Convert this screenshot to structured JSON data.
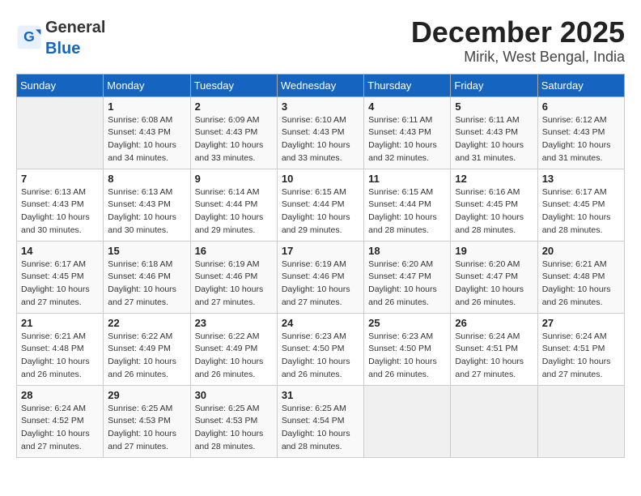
{
  "header": {
    "logo_general": "General",
    "logo_blue": "Blue",
    "title": "December 2025",
    "subtitle": "Mirik, West Bengal, India"
  },
  "calendar": {
    "days_of_week": [
      "Sunday",
      "Monday",
      "Tuesday",
      "Wednesday",
      "Thursday",
      "Friday",
      "Saturday"
    ],
    "weeks": [
      [
        {
          "day": "",
          "info": ""
        },
        {
          "day": "1",
          "info": "Sunrise: 6:08 AM\nSunset: 4:43 PM\nDaylight: 10 hours\nand 34 minutes."
        },
        {
          "day": "2",
          "info": "Sunrise: 6:09 AM\nSunset: 4:43 PM\nDaylight: 10 hours\nand 33 minutes."
        },
        {
          "day": "3",
          "info": "Sunrise: 6:10 AM\nSunset: 4:43 PM\nDaylight: 10 hours\nand 33 minutes."
        },
        {
          "day": "4",
          "info": "Sunrise: 6:11 AM\nSunset: 4:43 PM\nDaylight: 10 hours\nand 32 minutes."
        },
        {
          "day": "5",
          "info": "Sunrise: 6:11 AM\nSunset: 4:43 PM\nDaylight: 10 hours\nand 31 minutes."
        },
        {
          "day": "6",
          "info": "Sunrise: 6:12 AM\nSunset: 4:43 PM\nDaylight: 10 hours\nand 31 minutes."
        }
      ],
      [
        {
          "day": "7",
          "info": "Sunrise: 6:13 AM\nSunset: 4:43 PM\nDaylight: 10 hours\nand 30 minutes."
        },
        {
          "day": "8",
          "info": "Sunrise: 6:13 AM\nSunset: 4:43 PM\nDaylight: 10 hours\nand 30 minutes."
        },
        {
          "day": "9",
          "info": "Sunrise: 6:14 AM\nSunset: 4:44 PM\nDaylight: 10 hours\nand 29 minutes."
        },
        {
          "day": "10",
          "info": "Sunrise: 6:15 AM\nSunset: 4:44 PM\nDaylight: 10 hours\nand 29 minutes."
        },
        {
          "day": "11",
          "info": "Sunrise: 6:15 AM\nSunset: 4:44 PM\nDaylight: 10 hours\nand 28 minutes."
        },
        {
          "day": "12",
          "info": "Sunrise: 6:16 AM\nSunset: 4:45 PM\nDaylight: 10 hours\nand 28 minutes."
        },
        {
          "day": "13",
          "info": "Sunrise: 6:17 AM\nSunset: 4:45 PM\nDaylight: 10 hours\nand 28 minutes."
        }
      ],
      [
        {
          "day": "14",
          "info": "Sunrise: 6:17 AM\nSunset: 4:45 PM\nDaylight: 10 hours\nand 27 minutes."
        },
        {
          "day": "15",
          "info": "Sunrise: 6:18 AM\nSunset: 4:46 PM\nDaylight: 10 hours\nand 27 minutes."
        },
        {
          "day": "16",
          "info": "Sunrise: 6:19 AM\nSunset: 4:46 PM\nDaylight: 10 hours\nand 27 minutes."
        },
        {
          "day": "17",
          "info": "Sunrise: 6:19 AM\nSunset: 4:46 PM\nDaylight: 10 hours\nand 27 minutes."
        },
        {
          "day": "18",
          "info": "Sunrise: 6:20 AM\nSunset: 4:47 PM\nDaylight: 10 hours\nand 26 minutes."
        },
        {
          "day": "19",
          "info": "Sunrise: 6:20 AM\nSunset: 4:47 PM\nDaylight: 10 hours\nand 26 minutes."
        },
        {
          "day": "20",
          "info": "Sunrise: 6:21 AM\nSunset: 4:48 PM\nDaylight: 10 hours\nand 26 minutes."
        }
      ],
      [
        {
          "day": "21",
          "info": "Sunrise: 6:21 AM\nSunset: 4:48 PM\nDaylight: 10 hours\nand 26 minutes."
        },
        {
          "day": "22",
          "info": "Sunrise: 6:22 AM\nSunset: 4:49 PM\nDaylight: 10 hours\nand 26 minutes."
        },
        {
          "day": "23",
          "info": "Sunrise: 6:22 AM\nSunset: 4:49 PM\nDaylight: 10 hours\nand 26 minutes."
        },
        {
          "day": "24",
          "info": "Sunrise: 6:23 AM\nSunset: 4:50 PM\nDaylight: 10 hours\nand 26 minutes."
        },
        {
          "day": "25",
          "info": "Sunrise: 6:23 AM\nSunset: 4:50 PM\nDaylight: 10 hours\nand 26 minutes."
        },
        {
          "day": "26",
          "info": "Sunrise: 6:24 AM\nSunset: 4:51 PM\nDaylight: 10 hours\nand 27 minutes."
        },
        {
          "day": "27",
          "info": "Sunrise: 6:24 AM\nSunset: 4:51 PM\nDaylight: 10 hours\nand 27 minutes."
        }
      ],
      [
        {
          "day": "28",
          "info": "Sunrise: 6:24 AM\nSunset: 4:52 PM\nDaylight: 10 hours\nand 27 minutes."
        },
        {
          "day": "29",
          "info": "Sunrise: 6:25 AM\nSunset: 4:53 PM\nDaylight: 10 hours\nand 27 minutes."
        },
        {
          "day": "30",
          "info": "Sunrise: 6:25 AM\nSunset: 4:53 PM\nDaylight: 10 hours\nand 28 minutes."
        },
        {
          "day": "31",
          "info": "Sunrise: 6:25 AM\nSunset: 4:54 PM\nDaylight: 10 hours\nand 28 minutes."
        },
        {
          "day": "",
          "info": ""
        },
        {
          "day": "",
          "info": ""
        },
        {
          "day": "",
          "info": ""
        }
      ]
    ]
  }
}
